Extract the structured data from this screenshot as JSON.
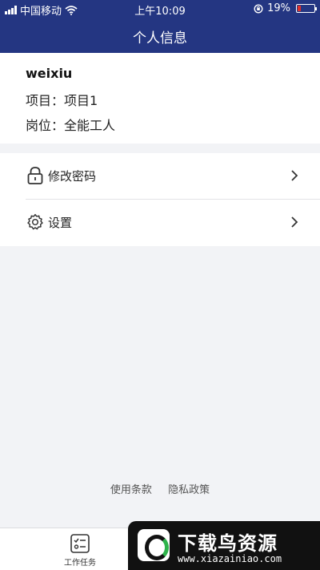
{
  "status_bar": {
    "carrier": "中国移动",
    "time": "上午10:09",
    "battery": "19%",
    "battery_level": 0.19
  },
  "header": {
    "title": "个人信息"
  },
  "profile": {
    "username": "weixiu",
    "project_label": "项目：",
    "project_value": "项目1",
    "position_label": "岗位：",
    "position_value": "全能工人"
  },
  "menu": {
    "items": [
      {
        "label": "修改密码",
        "icon": "lock-icon"
      },
      {
        "label": "设置",
        "icon": "gear-icon"
      }
    ]
  },
  "footer_links": {
    "terms": "使用条款",
    "privacy": "隐私政策"
  },
  "tabbar": {
    "tabs": [
      {
        "label": "工作任务",
        "icon": "task-list-icon"
      }
    ]
  },
  "watermark": {
    "title": "下载鸟资源",
    "url": "www.xiazainiao.com"
  },
  "colors": {
    "header_bg": "#243682",
    "page_bg": "#f2f3f6",
    "battery_low": "#e0302a"
  }
}
